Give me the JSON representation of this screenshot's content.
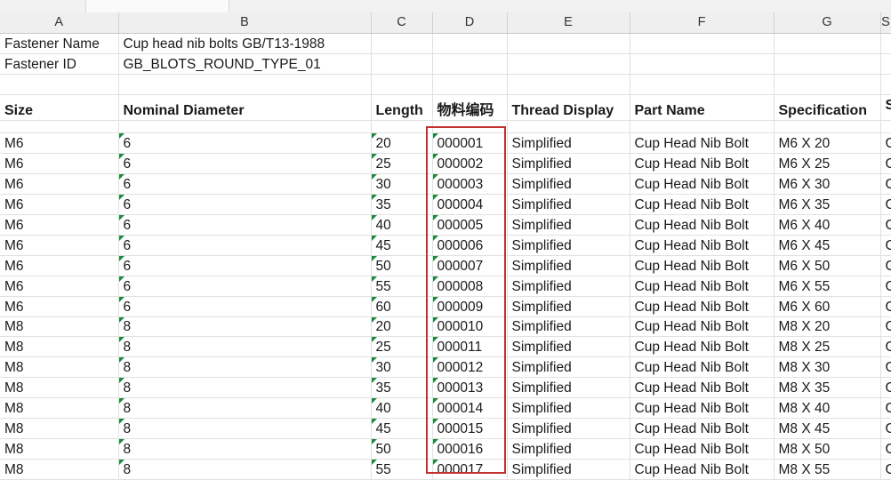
{
  "columns": [
    "A",
    "B",
    "C",
    "D",
    "E",
    "F",
    "G",
    "S"
  ],
  "meta": {
    "fastener_name_label": "Fastener Name",
    "fastener_name_value": "Cup head nib bolts GB/T13-1988",
    "fastener_id_label": "Fastener ID",
    "fastener_id_value": "GB_BLOTS_ROUND_TYPE_01"
  },
  "headers": [
    "Size",
    "Nominal  Diameter",
    "Length",
    "物料编码",
    "Thread Display",
    "Part Name",
    "Specification",
    "S"
  ],
  "rows": [
    {
      "size": "M6",
      "diameter": "6",
      "length": "20",
      "code": "000001",
      "thread": "Simplified",
      "part": "Cup Head Nib Bolt",
      "spec": "M6 X 20",
      "extra": "G"
    },
    {
      "size": "M6",
      "diameter": "6",
      "length": "25",
      "code": "000002",
      "thread": "Simplified",
      "part": "Cup Head Nib Bolt",
      "spec": "M6 X 25",
      "extra": "G"
    },
    {
      "size": "M6",
      "diameter": "6",
      "length": "30",
      "code": "000003",
      "thread": "Simplified",
      "part": "Cup Head Nib Bolt",
      "spec": "M6 X 30",
      "extra": "G"
    },
    {
      "size": "M6",
      "diameter": "6",
      "length": "35",
      "code": "000004",
      "thread": "Simplified",
      "part": "Cup Head Nib Bolt",
      "spec": "M6 X 35",
      "extra": "G"
    },
    {
      "size": "M6",
      "diameter": "6",
      "length": "40",
      "code": "000005",
      "thread": "Simplified",
      "part": "Cup Head Nib Bolt",
      "spec": "M6 X 40",
      "extra": "G"
    },
    {
      "size": "M6",
      "diameter": "6",
      "length": "45",
      "code": "000006",
      "thread": "Simplified",
      "part": "Cup Head Nib Bolt",
      "spec": "M6 X 45",
      "extra": "G"
    },
    {
      "size": "M6",
      "diameter": "6",
      "length": "50",
      "code": "000007",
      "thread": "Simplified",
      "part": "Cup Head Nib Bolt",
      "spec": "M6 X 50",
      "extra": "G"
    },
    {
      "size": "M6",
      "diameter": "6",
      "length": "55",
      "code": "000008",
      "thread": "Simplified",
      "part": "Cup Head Nib Bolt",
      "spec": "M6 X 55",
      "extra": "G"
    },
    {
      "size": "M6",
      "diameter": "6",
      "length": "60",
      "code": "000009",
      "thread": "Simplified",
      "part": "Cup Head Nib Bolt",
      "spec": "M6 X 60",
      "extra": "G"
    },
    {
      "size": "M8",
      "diameter": "8",
      "length": "20",
      "code": "000010",
      "thread": "Simplified",
      "part": "Cup Head Nib Bolt",
      "spec": "M8 X 20",
      "extra": "G"
    },
    {
      "size": "M8",
      "diameter": "8",
      "length": "25",
      "code": "000011",
      "thread": "Simplified",
      "part": "Cup Head Nib Bolt",
      "spec": "M8 X 25",
      "extra": "G"
    },
    {
      "size": "M8",
      "diameter": "8",
      "length": "30",
      "code": "000012",
      "thread": "Simplified",
      "part": "Cup Head Nib Bolt",
      "spec": "M8 X 30",
      "extra": "G"
    },
    {
      "size": "M8",
      "diameter": "8",
      "length": "35",
      "code": "000013",
      "thread": "Simplified",
      "part": "Cup Head Nib Bolt",
      "spec": "M8 X 35",
      "extra": "G"
    },
    {
      "size": "M8",
      "diameter": "8",
      "length": "40",
      "code": "000014",
      "thread": "Simplified",
      "part": "Cup Head Nib Bolt",
      "spec": "M8 X 40",
      "extra": "G"
    },
    {
      "size": "M8",
      "diameter": "8",
      "length": "45",
      "code": "000015",
      "thread": "Simplified",
      "part": "Cup Head Nib Bolt",
      "spec": "M8 X 45",
      "extra": "G"
    },
    {
      "size": "M8",
      "diameter": "8",
      "length": "50",
      "code": "000016",
      "thread": "Simplified",
      "part": "Cup Head Nib Bolt",
      "spec": "M8 X 50",
      "extra": "G"
    },
    {
      "size": "M8",
      "diameter": "8",
      "length": "55",
      "code": "000017",
      "thread": "Simplified",
      "part": "Cup Head Nib Bolt",
      "spec": "M8 X 55",
      "extra": "G"
    }
  ],
  "colors": {
    "highlight_border": "#c22f2f",
    "number_as_text_marker": "#1b8a3c",
    "gridline": "#e1e1e1",
    "column_header_bg": "#efefef"
  }
}
